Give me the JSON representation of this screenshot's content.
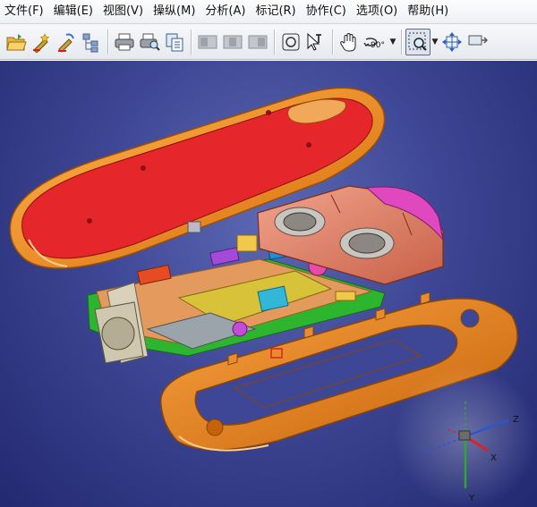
{
  "menu": {
    "items": [
      {
        "label": "文件(F)"
      },
      {
        "label": "编辑(E)"
      },
      {
        "label": "视图(V)"
      },
      {
        "label": "操纵(M)"
      },
      {
        "label": "分析(A)"
      },
      {
        "label": "标记(R)"
      },
      {
        "label": "协作(C)"
      },
      {
        "label": "选项(O)"
      },
      {
        "label": "帮助(H)"
      }
    ]
  },
  "toolbar": {
    "rotate_label": "90°"
  },
  "triad": {
    "z_label": "Z",
    "x_label": "X",
    "y_label": "Y"
  },
  "colors": {
    "background": "#3e4795",
    "shell_orange": "#f08a1c",
    "battery_red": "#e8262a",
    "pcb_green": "#2fb830",
    "speaker_housing": "#e3826a",
    "speaker_accent": "#e040c0"
  }
}
